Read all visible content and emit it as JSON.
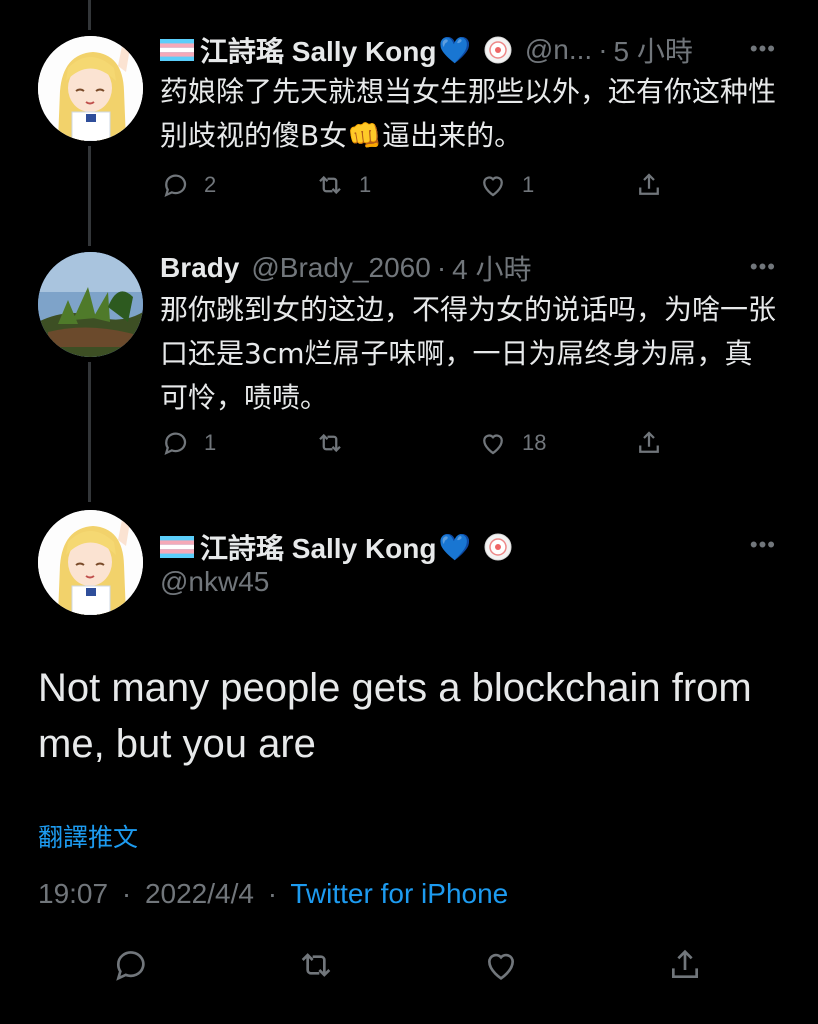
{
  "tweets": [
    {
      "display_name": "江詩瑤 Sally Kong",
      "heart": "💙",
      "handle": "@n...",
      "time": "5 小時",
      "text": "药娘除了先天就想当女生那些以外，还有你这种性别歧视的傻B女👊逼出来的。",
      "replies": "2",
      "retweets": "1",
      "likes": "1"
    },
    {
      "display_name": "Brady",
      "handle": "@Brady_2060",
      "time": "4 小時",
      "text": "那你跳到女的这边，不得为女的说话吗，为啥一张口还是3cm烂屌子味啊，一日为屌终身为屌，真可怜，啧啧。",
      "replies": "1",
      "retweets": "",
      "likes": "18"
    }
  ],
  "main_tweet": {
    "display_name": "江詩瑤 Sally Kong",
    "heart": "💙",
    "handle": "@nkw45",
    "text": "Not many people gets a blockchain from me, but you are",
    "translate": "翻譯推文",
    "time": "19:07",
    "date": "2022/4/4",
    "source": "Twitter for iPhone"
  },
  "separator": "·",
  "more_label": "•••",
  "icons": {
    "reply": "reply-icon",
    "retweet": "retweet-icon",
    "like": "heart-icon",
    "share": "share-icon",
    "flag": "trans-flag-icon",
    "badge": "sticker-badge-icon"
  },
  "colors": {
    "background": "#000000",
    "text": "#e7e9ea",
    "muted": "#71767b",
    "link": "#1d9bf0"
  }
}
